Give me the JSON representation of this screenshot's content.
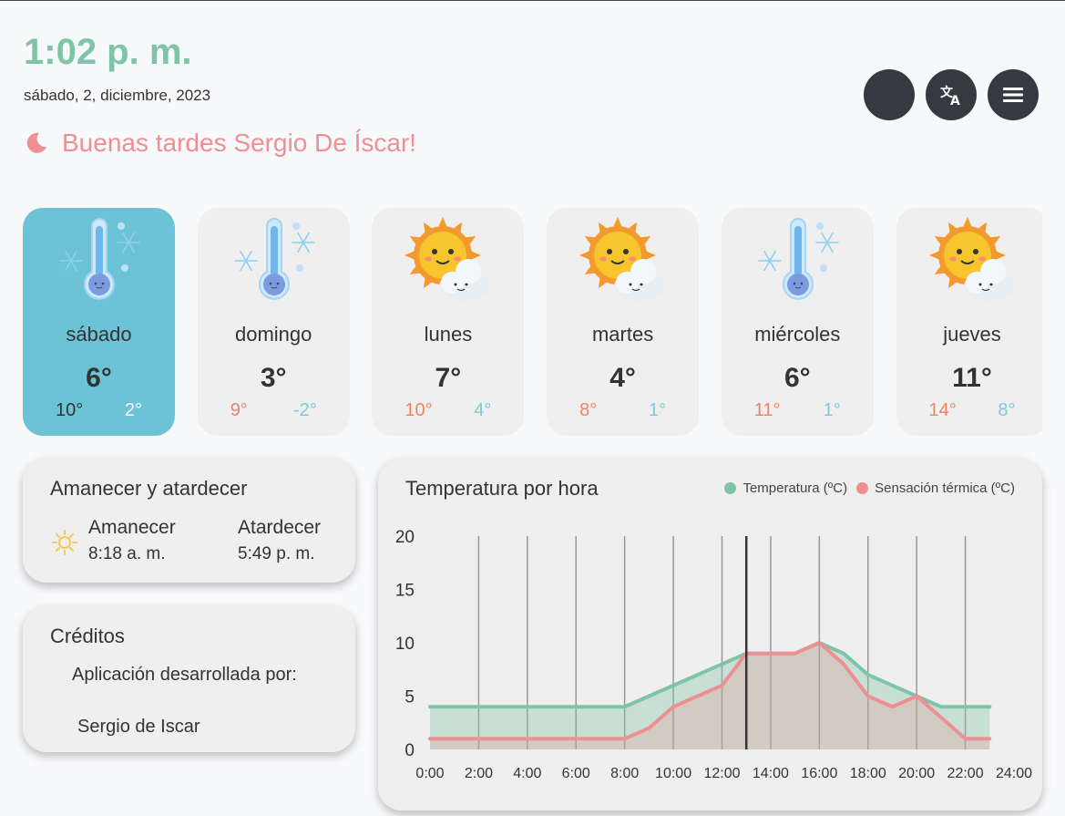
{
  "header": {
    "time": "1:02 p. m.",
    "date": "sábado, 2, diciembre, 2023",
    "greeting": "Buenas tardes Sergio De Íscar!"
  },
  "buttons": [
    {
      "name": "theme-toggle-button",
      "icon": "moon-icon"
    },
    {
      "name": "translate-button",
      "icon": "translate-icon"
    },
    {
      "name": "menu-button",
      "icon": "menu-icon"
    }
  ],
  "days": [
    {
      "name": "sábado",
      "temp": "6°",
      "max": "10°",
      "min": "2°",
      "icon": "cold-thermometer-icon",
      "active": true
    },
    {
      "name": "domingo",
      "temp": "3°",
      "max": "9°",
      "min": "-2°",
      "icon": "cold-thermometer-icon",
      "active": false
    },
    {
      "name": "lunes",
      "temp": "7°",
      "max": "10°",
      "min": "4°",
      "icon": "sun-cloud-icon",
      "active": false
    },
    {
      "name": "martes",
      "temp": "4°",
      "max": "8°",
      "min": "1°",
      "icon": "sun-cloud-icon",
      "active": false
    },
    {
      "name": "miércoles",
      "temp": "6°",
      "max": "11°",
      "min": "1°",
      "icon": "cold-thermometer-icon",
      "active": false
    },
    {
      "name": "jueves",
      "temp": "11°",
      "max": "14°",
      "min": "8°",
      "icon": "sun-cloud-icon",
      "active": false
    }
  ],
  "sun": {
    "title": "Amanecer y atardecer",
    "sunrise_label": "Amanecer",
    "sunrise_time": "8:18 a. m.",
    "sunset_label": "Atardecer",
    "sunset_time": "5:49 p. m."
  },
  "credits": {
    "title": "Créditos",
    "line1": "Aplicación desarrollada por:",
    "line2": "Sergio de Iscar"
  },
  "colors": {
    "accent_green": "#7ec4a7",
    "accent_pink": "#ee8f93",
    "active_card": "#6cc3d6",
    "button_dark": "#353a40"
  },
  "chart_data": {
    "type": "area",
    "title": "Temperatura por hora",
    "x_ticks": [
      "0:00",
      "2:00",
      "4:00",
      "6:00",
      "8:00",
      "10:00",
      "12:00",
      "14:00",
      "16:00",
      "18:00",
      "20:00",
      "22:00",
      "24:00"
    ],
    "y_ticks": [
      0,
      5,
      10,
      15,
      20
    ],
    "ylim": [
      0,
      20
    ],
    "xlim": [
      0,
      24
    ],
    "current_hour": 13,
    "series": [
      {
        "name": "Temperatura (ºC)",
        "color": "#7ec4a7",
        "x": [
          0,
          1,
          2,
          3,
          4,
          5,
          6,
          7,
          7.5,
          8,
          9,
          10,
          11,
          12,
          13,
          14,
          15,
          16,
          17,
          18,
          19,
          20,
          21,
          22,
          23
        ],
        "y": [
          4,
          4,
          4,
          4,
          4,
          4,
          4,
          4,
          4,
          4,
          5,
          6,
          7,
          8,
          9,
          9,
          9,
          10,
          9,
          7,
          6,
          5,
          4,
          4,
          4
        ]
      },
      {
        "name": "Sensación térmica (ºC)",
        "color": "#ee8f93",
        "x": [
          0,
          1,
          2,
          3,
          4,
          5,
          6,
          7,
          7.5,
          8,
          9,
          10,
          11,
          12,
          13,
          14,
          15,
          16,
          17,
          18,
          19,
          20,
          21,
          22,
          23
        ],
        "y": [
          1,
          1,
          1,
          1,
          1,
          1,
          1,
          1,
          1,
          1,
          2,
          4,
          5,
          6,
          9,
          9,
          9,
          10,
          8,
          5,
          4,
          5,
          3,
          1,
          1
        ]
      }
    ]
  }
}
